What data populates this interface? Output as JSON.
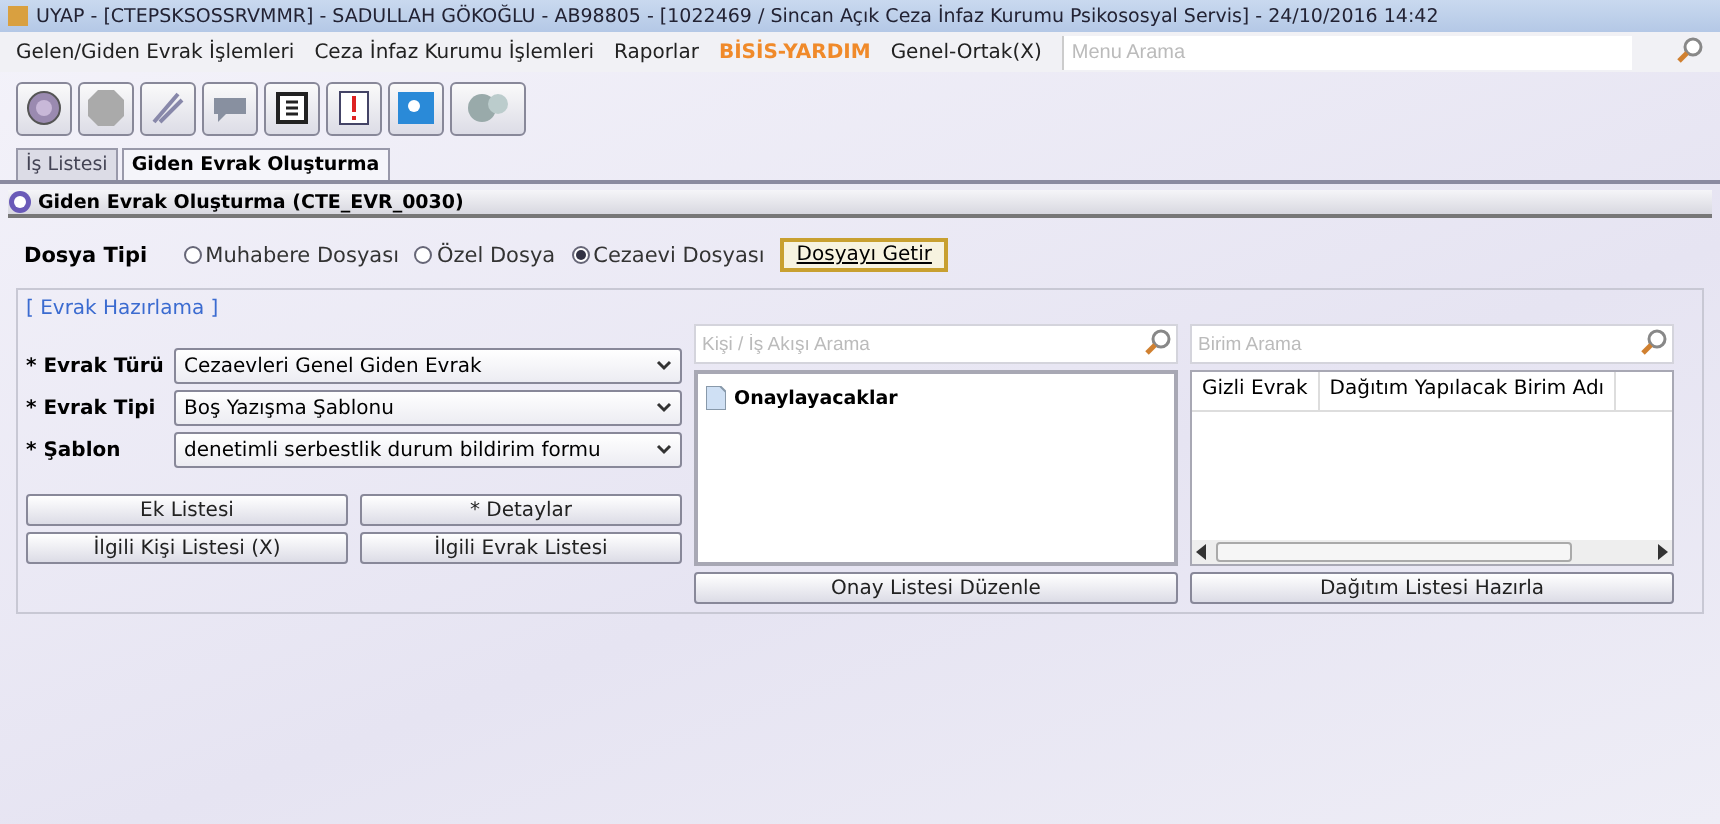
{
  "window": {
    "title": "UYAP - [CTEPSKSOSSRVMMR] - SADULLAH GÖKOĞLU - AB98805 - [1022469 / Sincan Açık Ceza İnfaz Kurumu Psikososyal Servis] - 24/10/2016 14:42"
  },
  "menu": [
    {
      "label": "Gelen/Giden Evrak İşlemleri",
      "kind": "normal"
    },
    {
      "label": "Ceza İnfaz Kurumu İşlemleri",
      "kind": "normal"
    },
    {
      "label": "Raporlar",
      "kind": "normal"
    },
    {
      "label": "BİSİS-YARDIM",
      "kind": "help"
    },
    {
      "label": "Genel-Ortak(X)",
      "kind": "normal"
    }
  ],
  "menu_search": {
    "placeholder": "Menu Arama"
  },
  "tabs": [
    {
      "label": "İş Listesi",
      "selected": false
    },
    {
      "label": "Giden Evrak Oluşturma",
      "selected": true
    }
  ],
  "section_title": "Giden Evrak Oluşturma (CTE_EVR_0030)",
  "dosya_tipi": {
    "label": "Dosya Tipi",
    "options": [
      {
        "label": "Muhabere Dosyası",
        "selected": false
      },
      {
        "label": "Özel Dosya",
        "selected": false
      },
      {
        "label": "Cezaevi Dosyası",
        "selected": true
      }
    ],
    "button": "Dosyayı Getir"
  },
  "group_title": "[ Evrak Hazırlama ]",
  "fields": [
    {
      "label": "* Evrak Türü",
      "value": "Cezaevleri Genel Giden Evrak"
    },
    {
      "label": "* Evrak Tipi",
      "value": "Boş Yazışma Şablonu"
    },
    {
      "label": "* Şablon",
      "value": "denetimli serbestlik durum bildirim formu"
    }
  ],
  "left_buttons": [
    "Ek Listesi",
    "* Detaylar",
    "İlgili Kişi Listesi (X)",
    "İlgili Evrak Listesi"
  ],
  "approval": {
    "placeholder": "Kişi / İş Akışı Arama",
    "items": [
      "Onaylayacaklar"
    ],
    "button": "Onay Listesi Düzenle"
  },
  "distribution": {
    "placeholder": "Birim Arama",
    "columns": [
      "Gizli Evrak",
      "Dağıtım Yapılacak Birim Adı"
    ],
    "button": "Dağıtım Listesi Hazırla"
  }
}
